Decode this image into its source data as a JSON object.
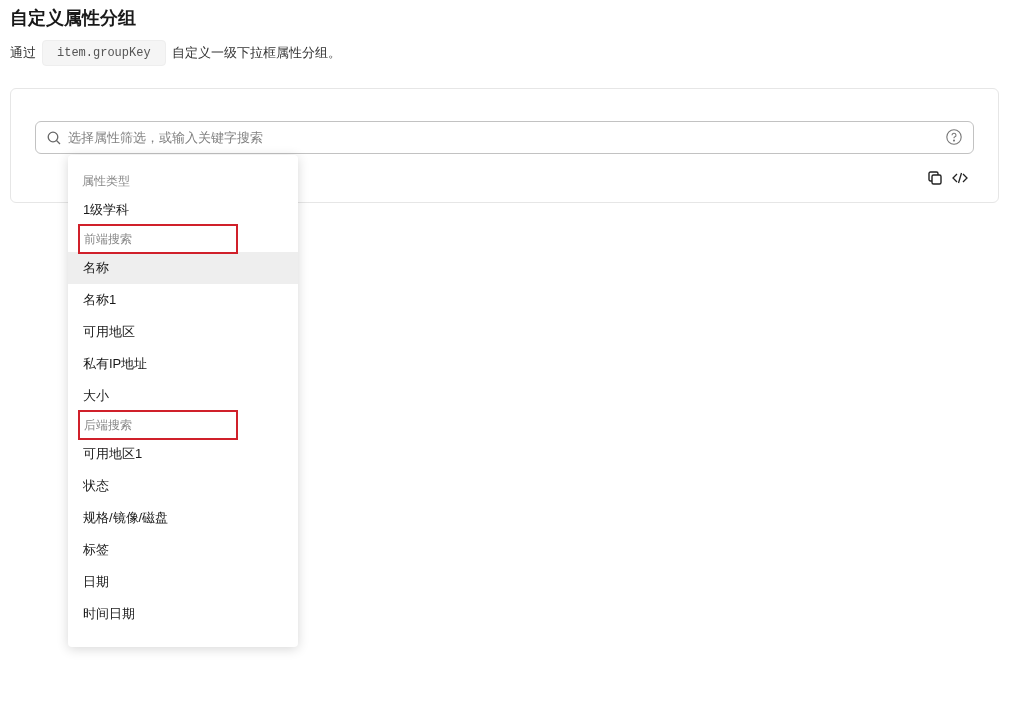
{
  "title": "自定义属性分组",
  "description": {
    "before": "通过",
    "code": "item.groupKey",
    "after": "自定义一级下拉框属性分组。"
  },
  "search": {
    "placeholder": "选择属性筛选，或输入关键字搜索"
  },
  "dropdown": {
    "groups": [
      {
        "label": "属性类型",
        "highlighted": false,
        "items": [
          {
            "label": "1级学科",
            "selected": false
          }
        ]
      },
      {
        "label": "前端搜索",
        "highlighted": true,
        "items": [
          {
            "label": "名称",
            "selected": true
          },
          {
            "label": "名称1",
            "selected": false
          },
          {
            "label": "可用地区",
            "selected": false
          },
          {
            "label": "私有IP地址",
            "selected": false
          },
          {
            "label": "大小",
            "selected": false
          }
        ]
      },
      {
        "label": "后端搜索",
        "highlighted": true,
        "items": [
          {
            "label": "可用地区1",
            "selected": false
          },
          {
            "label": "状态",
            "selected": false
          },
          {
            "label": "规格/镜像/磁盘",
            "selected": false
          },
          {
            "label": "标签",
            "selected": false
          },
          {
            "label": "日期",
            "selected": false
          },
          {
            "label": "时间日期",
            "selected": false
          }
        ]
      }
    ]
  }
}
